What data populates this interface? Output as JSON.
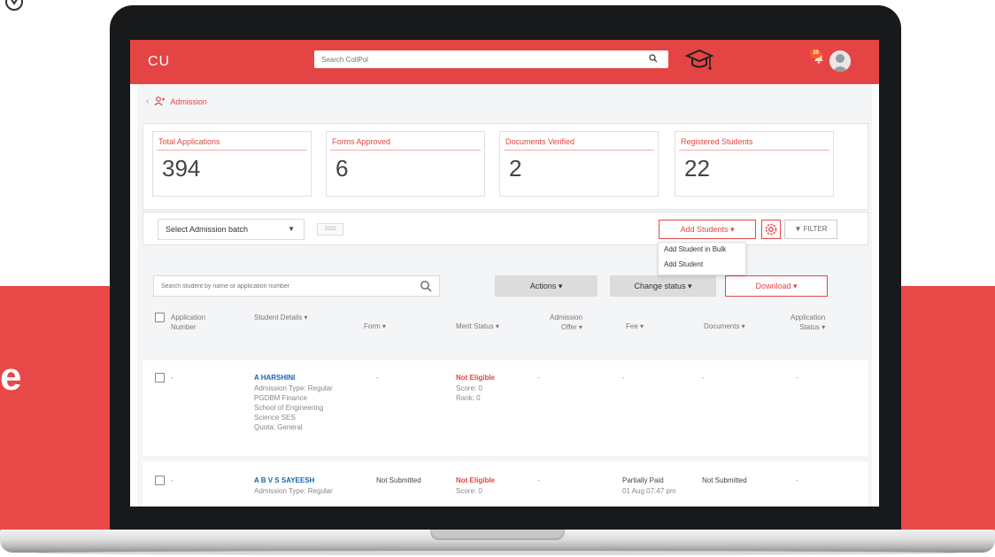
{
  "app": {
    "title": "CU"
  },
  "header": {
    "search_placeholder": "Search CollPol",
    "notification_count": "30"
  },
  "breadcrumb": {
    "label": "Admission"
  },
  "stats": [
    {
      "label": "Total Applications",
      "value": "394"
    },
    {
      "label": "Forms Approved",
      "value": "6"
    },
    {
      "label": "Documents Verified",
      "value": "2"
    },
    {
      "label": "Registered Students",
      "value": "22"
    }
  ],
  "batch": {
    "select_label": "Select Admission batch",
    "year": "2022"
  },
  "toolbar": {
    "add_students": "Add Students ▾",
    "filter": "▼ FILTER",
    "add_menu": [
      "Add Student in Bulk",
      "Add Student"
    ],
    "search_placeholder": "Search student by name or application number",
    "actions": "Actions ▾",
    "change_status": "Change status ▾",
    "download": "Download ▾"
  },
  "table": {
    "headers": {
      "application_number": "Application\nNumber",
      "student_details": "Student Details ▾",
      "form": "Form ▾",
      "merit_status": "Merit Status ▾",
      "admission_offer": "Admission\nOffer ▾",
      "fee": "Fee ▾",
      "documents": "Documents ▾",
      "application_status": "Application\nStatus ▾"
    },
    "rows": [
      {
        "app_no": "-",
        "name": "A HARSHINI",
        "details": "Admission Type: Regular\nPGDBM Finance\nSchool of Engineering\nScience SES\nQuota: General",
        "form": "-",
        "merit": "Not Eligible",
        "merit_detail": "Score: 0\nRank: 0",
        "offer": "-",
        "fee": "-",
        "fee_detail": "",
        "documents": "-",
        "app_status": "-"
      },
      {
        "app_no": "-",
        "name": "A B V S SAYEESH",
        "details": "Admission Type: Regular",
        "form": "Not Submitted",
        "merit": "Not Eligible",
        "merit_detail": "Score: 0",
        "offer": "-",
        "fee": "Partially Paid",
        "fee_detail": "01 Aug 07:47 pm",
        "documents": "Not Submitted",
        "app_status": "-"
      }
    ]
  },
  "side_text": "e",
  "colors": {
    "brand": "#e54444",
    "link": "#1b64b0",
    "background_band": "#e84848"
  }
}
